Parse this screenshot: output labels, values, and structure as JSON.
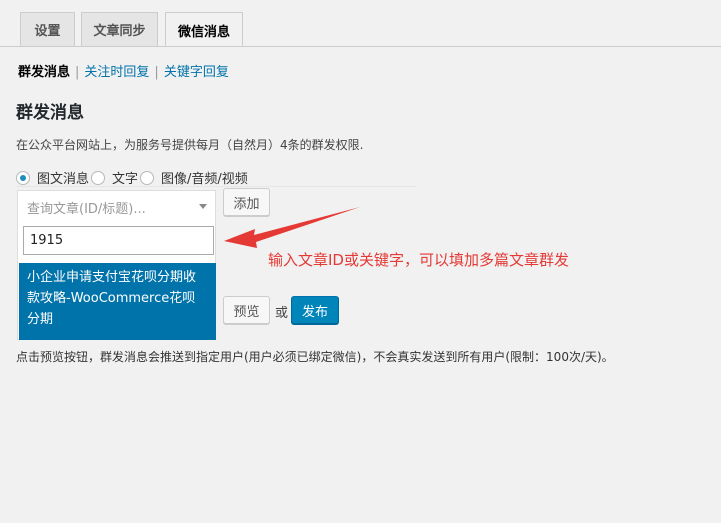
{
  "tabs": [
    {
      "label": "设置"
    },
    {
      "label": "文章同步"
    },
    {
      "label": "微信消息"
    }
  ],
  "subnav": {
    "current": "群发消息",
    "links": [
      "关注时回复",
      "关键字回复"
    ],
    "separator": "|"
  },
  "section": {
    "title": "群发消息",
    "description": "在公众平台网站上，为服务号提供每月（自然月）4条的群发权限."
  },
  "message_types": [
    {
      "label": "图文消息",
      "selected": true
    },
    {
      "label": "文字",
      "selected": false
    },
    {
      "label": "图像/音频/视频",
      "selected": false
    }
  ],
  "article_select": {
    "placeholder": "查询文章(ID/标题)...",
    "search_value": "1915",
    "result": "小企业申请支付宝花呗分期收款攻略-WooCommerce花呗分期"
  },
  "buttons": {
    "add": "添加",
    "preview": "预览",
    "or": "或",
    "publish": "发布"
  },
  "note": "点击预览按钮，群发消息会推送到指定用户(用户必须已绑定微信)，不会真实发送到所有用户(限制：100次/天)。",
  "annotation": "输入文章ID或关键字，可以填加多篇文章群发",
  "colors": {
    "accent": "#0073aa",
    "primary_button": "#0085ba",
    "annotation": "#e53935",
    "background": "#f1f1f1"
  }
}
